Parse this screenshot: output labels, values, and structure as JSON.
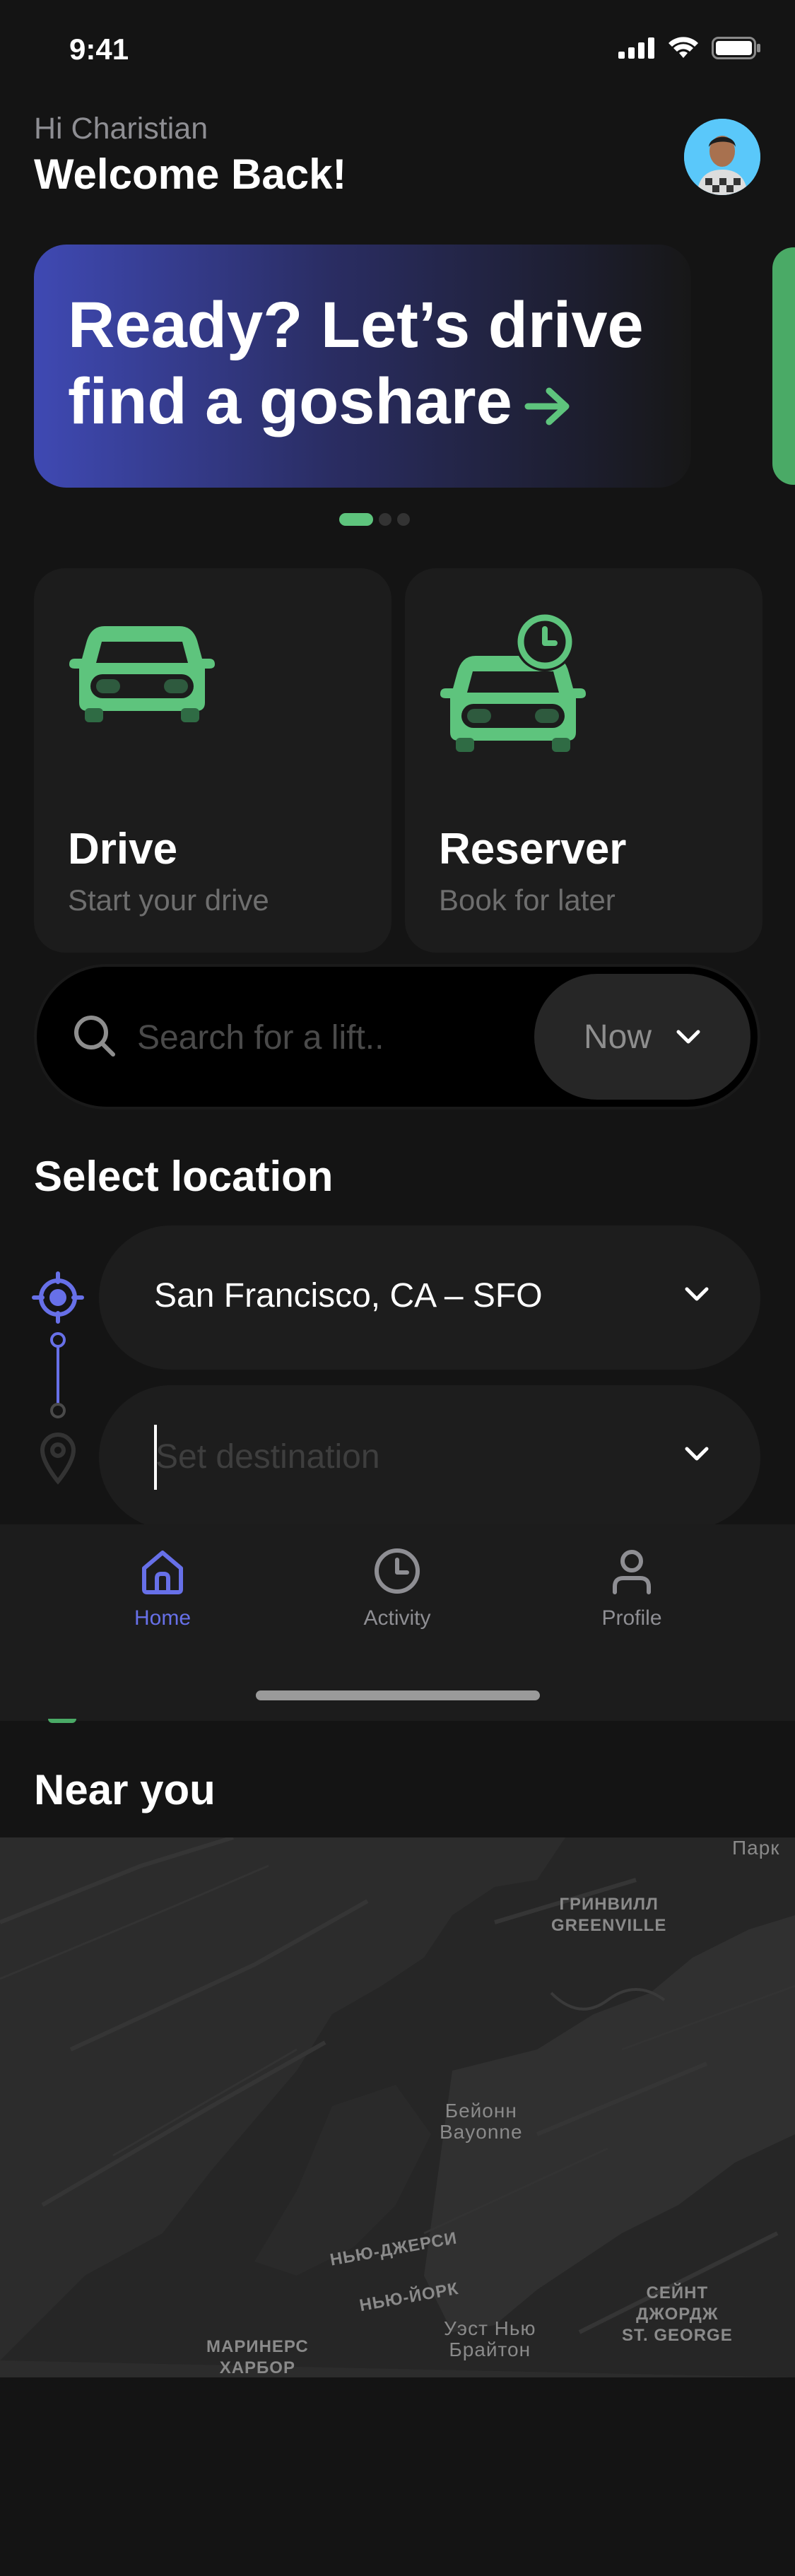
{
  "status_bar": {
    "time": "9:41"
  },
  "greeting": {
    "subtitle": "Hi Charistian",
    "title": "Welcome Back!"
  },
  "banner": {
    "line1": "Ready? Let’s drive",
    "line2": "find a goshare",
    "arrow_icon": "arrow-right-icon"
  },
  "carousel": {
    "page_count": 3,
    "active_index": 0
  },
  "services": [
    {
      "title": "Drive",
      "subtitle": "Start your drive",
      "icon": "car-icon"
    },
    {
      "title": "Reserver",
      "subtitle": "Book for later",
      "icon": "car-clock-icon"
    }
  ],
  "search": {
    "placeholder": "Search for a lift..",
    "time_option": "Now"
  },
  "location": {
    "title": "Select location",
    "from": "San Francisco, CA – SFO",
    "to_placeholder": "Set destination"
  },
  "tabs": [
    {
      "label": "Home",
      "icon": "home-icon",
      "active": true
    },
    {
      "label": "Activity",
      "icon": "clock-icon",
      "active": false
    },
    {
      "label": "Profile",
      "icon": "user-icon",
      "active": false
    }
  ],
  "near_you": {
    "title": "Near you",
    "map_labels": {
      "greenville": "ГРИНВИЛЛ\nGREENVILLE",
      "bayonne": "Бейонн\nBayonne",
      "nj": "НЬЮ-ДЖЕРСИ",
      "ny": "НЬЮ-ЙОРК",
      "west_brighton": "Уэст Нью\nБрайтон",
      "st_george": "СЕЙНТ\nДЖОРДЖ\nST. GEORGE",
      "mariners": "МАРИНЕРС\nХАРБОР",
      "park": "Парк"
    }
  },
  "colors": {
    "accent_green": "#5ec47d",
    "accent_blue": "#6770e8",
    "background": "#141414",
    "card": "#1c1c1c"
  }
}
